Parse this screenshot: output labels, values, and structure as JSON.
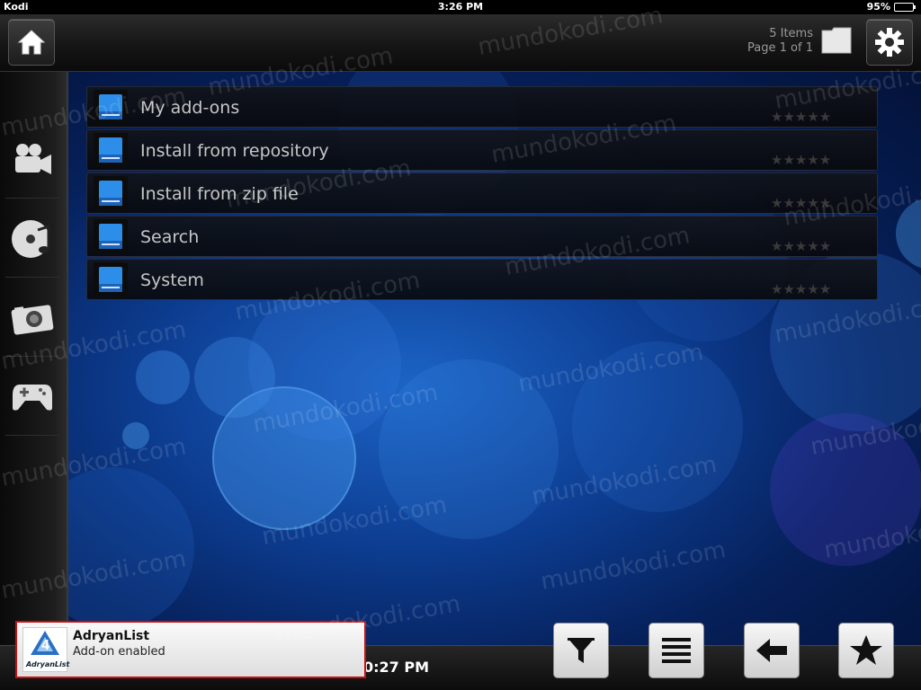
{
  "status_bar": {
    "carrier": "Kodi",
    "time": "3:26 PM",
    "battery": "95%",
    "battery_level": 0.95
  },
  "top_bar": {
    "items_count": "5 Items",
    "page": "Page 1 of 1"
  },
  "sidebar": {
    "items": [
      {
        "name": "videos",
        "icon": "video-camera-icon"
      },
      {
        "name": "music",
        "icon": "music-disc-icon"
      },
      {
        "name": "pictures",
        "icon": "camera-icon"
      },
      {
        "name": "games",
        "icon": "gamepad-icon"
      }
    ]
  },
  "list": {
    "items": [
      {
        "label": "My add-ons",
        "rating": "★★★★★"
      },
      {
        "label": "Install from repository",
        "rating": "★★★★★"
      },
      {
        "label": "Install from zip file",
        "rating": "★★★★★"
      },
      {
        "label": "Search",
        "rating": "★★★★★"
      },
      {
        "label": "System",
        "rating": "★★★★★"
      }
    ]
  },
  "bottom_bar": {
    "time": "0:27 PM",
    "buttons": [
      {
        "name": "filter",
        "icon": "filter-icon"
      },
      {
        "name": "view-list",
        "icon": "list-icon"
      },
      {
        "name": "back",
        "icon": "arrow-left-icon"
      },
      {
        "name": "favourites",
        "icon": "star-icon"
      }
    ]
  },
  "notification": {
    "title": "AdryanList",
    "message": "Add-on enabled",
    "logo_text": "AdryanList"
  },
  "watermark": "mundokodi.com",
  "colors": {
    "accent_blue": "#1c64c6",
    "notification_border": "#c81010"
  }
}
